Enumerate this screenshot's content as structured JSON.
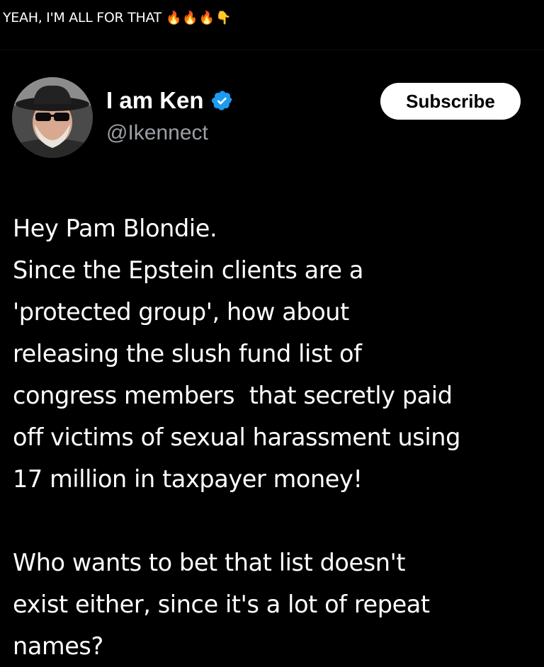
{
  "caption": {
    "text": "YEAH, I'M ALL FOR THAT",
    "emojis": "🔥🔥🔥👇"
  },
  "post": {
    "author_name": "I am Ken",
    "handle": "@Ikennect",
    "verified_icon": "verified-badge-icon",
    "avatar_icon": "avatar",
    "subscribe_label": "Subscribe",
    "lines": [
      "Hey Pam Blondie.",
      "Since the Epstein clients are a",
      "'protected group', how about",
      "releasing the slush fund list of",
      "congress members  that secretly paid",
      "off victims of sexual harassment using",
      "17 million in taxpayer money!",
      "",
      "Who wants to bet that list doesn't",
      "exist either, since it's a lot of repeat",
      "names?"
    ]
  },
  "colors": {
    "background": "#000000",
    "text": "#ffffff",
    "handle": "#9aa0a6",
    "verified": "#1d9bf0",
    "button_bg": "#ffffff"
  }
}
